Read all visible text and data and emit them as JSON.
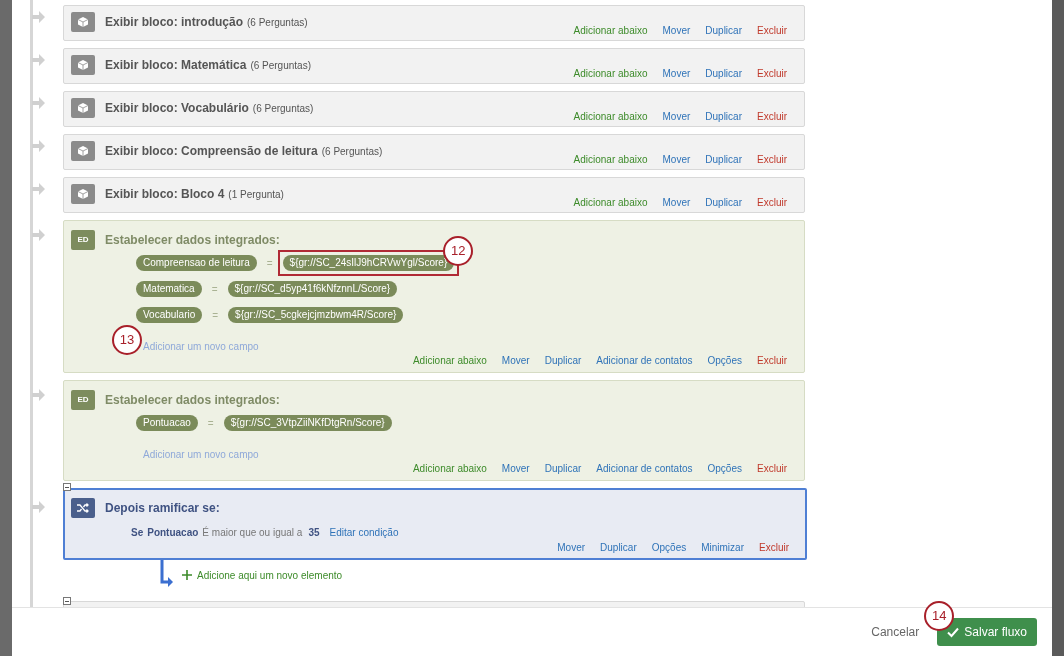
{
  "elements": [
    {
      "kind": "block",
      "title": "Exibir bloco: introdução",
      "count": "(6 Perguntas)",
      "actions": [
        {
          "label": "Adicionar abaixo",
          "kind": "add"
        },
        {
          "label": "Mover",
          "kind": "link"
        },
        {
          "label": "Duplicar",
          "kind": "link"
        },
        {
          "label": "Excluir",
          "kind": "delete"
        }
      ]
    },
    {
      "kind": "block",
      "title": "Exibir bloco: Matemática",
      "count": "(6 Perguntas)",
      "actions": [
        {
          "label": "Adicionar abaixo",
          "kind": "add"
        },
        {
          "label": "Mover",
          "kind": "link"
        },
        {
          "label": "Duplicar",
          "kind": "link"
        },
        {
          "label": "Excluir",
          "kind": "delete"
        }
      ]
    },
    {
      "kind": "block",
      "title": "Exibir bloco: Vocabulário",
      "count": "(6 Perguntas)",
      "actions": [
        {
          "label": "Adicionar abaixo",
          "kind": "add"
        },
        {
          "label": "Mover",
          "kind": "link"
        },
        {
          "label": "Duplicar",
          "kind": "link"
        },
        {
          "label": "Excluir",
          "kind": "delete"
        }
      ]
    },
    {
      "kind": "block",
      "title": "Exibir bloco: Compreensão de leitura",
      "count": "(6 Perguntas)",
      "actions": [
        {
          "label": "Adicionar abaixo",
          "kind": "add"
        },
        {
          "label": "Mover",
          "kind": "link"
        },
        {
          "label": "Duplicar",
          "kind": "link"
        },
        {
          "label": "Excluir",
          "kind": "delete"
        }
      ]
    },
    {
      "kind": "block",
      "title": "Exibir bloco: Bloco 4",
      "count": "(1 Pergunta)",
      "actions": [
        {
          "label": "Adicionar abaixo",
          "kind": "add"
        },
        {
          "label": "Mover",
          "kind": "link"
        },
        {
          "label": "Duplicar",
          "kind": "link"
        },
        {
          "label": "Excluir",
          "kind": "delete"
        }
      ]
    },
    {
      "kind": "embedded",
      "icon_label": "ED",
      "title": "Estabelecer dados integrados:",
      "fields": [
        {
          "name": "Compreensao de leitura",
          "equals": "=",
          "value": "${gr://SC_24sIlJ9hCRVwYgl/Score}",
          "highlighted": true,
          "callout": "12"
        },
        {
          "name": "Matematica",
          "equals": "=",
          "value": "${gr://SC_d5yp41f6kNfznnL/Score}",
          "highlighted": false
        },
        {
          "name": "Vocabulario",
          "equals": "=",
          "value": "${gr://SC_5cgkejcjmzbwm4R/Score}",
          "highlighted": false
        }
      ],
      "add_field": {
        "label": "Adicionar um novo campo",
        "callout": "13"
      },
      "actions": [
        {
          "label": "Adicionar abaixo",
          "kind": "add"
        },
        {
          "label": "Mover",
          "kind": "link"
        },
        {
          "label": "Duplicar",
          "kind": "link"
        },
        {
          "label": "Adicionar de contatos",
          "kind": "link"
        },
        {
          "label": "Opções",
          "kind": "link"
        },
        {
          "label": "Excluir",
          "kind": "delete"
        }
      ]
    },
    {
      "kind": "embedded",
      "icon_label": "ED",
      "title": "Estabelecer dados integrados:",
      "fields": [
        {
          "name": "Pontuacao",
          "equals": "=",
          "value": "${gr://SC_3VtpZiiNKfDtgRn/Score}",
          "highlighted": false
        }
      ],
      "add_field": {
        "label": "Adicionar um novo campo"
      },
      "actions": [
        {
          "label": "Adicionar abaixo",
          "kind": "add"
        },
        {
          "label": "Mover",
          "kind": "link"
        },
        {
          "label": "Duplicar",
          "kind": "link"
        },
        {
          "label": "Adicionar de contatos",
          "kind": "link"
        },
        {
          "label": "Opções",
          "kind": "link"
        },
        {
          "label": "Excluir",
          "kind": "delete"
        }
      ]
    },
    {
      "kind": "branch",
      "selected": true,
      "title": "Depois ramificar se:",
      "condition": {
        "prefix": "Se",
        "field": "Pontuacao",
        "operator": "É maior que ou igual a",
        "value": "35",
        "edit": "Editar condição"
      },
      "actions": [
        {
          "label": "Mover",
          "kind": "link"
        },
        {
          "label": "Duplicar",
          "kind": "link"
        },
        {
          "label": "Opções",
          "kind": "link"
        },
        {
          "label": "Minimizar",
          "kind": "link"
        },
        {
          "label": "Excluir",
          "kind": "delete"
        }
      ],
      "add_element": "Adicione aqui um novo elemento"
    }
  ],
  "footer": {
    "cancel": "Cancelar",
    "save": "Salvar fluxo",
    "callout": "14"
  }
}
